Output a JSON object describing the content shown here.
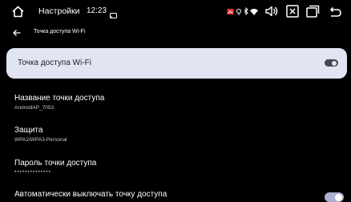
{
  "status_bar": {
    "title": "Настройки",
    "time": "12:23",
    "icons": [
      "home-icon",
      "cast-icon",
      "volume-icon",
      "close-box-icon",
      "recent-apps-icon",
      "back-icon"
    ],
    "status_icons": [
      "gallery-icon",
      "location-icon",
      "bluetooth-icon",
      "wifi-icon"
    ]
  },
  "subheader": {
    "title": "Точка доступа Wi-Fi"
  },
  "wifi_hotspot": {
    "label": "Точка доступа Wi-Fi",
    "enabled": false
  },
  "settings": {
    "hotspot_name": {
      "title": "Название точки доступа",
      "value": "AndroidAP_7053"
    },
    "security": {
      "title": "Защита",
      "value": "WPA2/WPA3-Personal"
    },
    "password": {
      "title": "Пароль точки доступа",
      "value": "••••••••••••••"
    },
    "auto_off": {
      "title": "Автоматически выключать точку доступа",
      "enabled": true
    }
  },
  "colors": {
    "background": "#000000",
    "card": "#e1e5f3",
    "toggle_off": "#44464f",
    "toggle_on": "#aab0cf"
  }
}
